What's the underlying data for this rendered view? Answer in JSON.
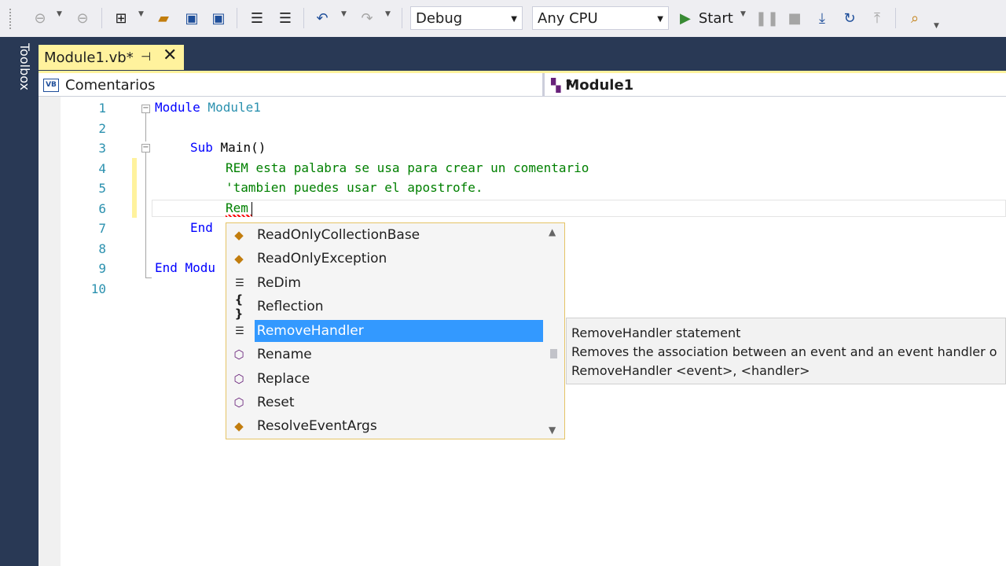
{
  "toolbar": {
    "config": "Debug",
    "platform": "Any CPU",
    "start_label": "Start"
  },
  "sidebar": {
    "toolbox_label": "Toolbox"
  },
  "tab": {
    "title": "Module1.vb*",
    "pin_glyph": "⊣",
    "close_glyph": "✕"
  },
  "navbar": {
    "left": "Comentarios",
    "right": "Module1",
    "vb_badge": "VB"
  },
  "editor": {
    "line_numbers": [
      "1",
      "2",
      "3",
      "4",
      "5",
      "6",
      "7",
      "8",
      "9",
      "10"
    ],
    "lines": {
      "l1_kw": "Module",
      "l1_name": " Module1",
      "l3_kw": "Sub",
      "l3_rest": " Main()",
      "l4": "REM esta palabra se usa para crear un comentario",
      "l5": "'tambien puedes usar el apostrofe.",
      "l6": "Rem",
      "l7": "End",
      "l9": "End Modu"
    }
  },
  "completion": {
    "items": [
      {
        "label": "ReadOnlyCollectionBase",
        "icon": "class-icon"
      },
      {
        "label": "ReadOnlyException",
        "icon": "class-icon"
      },
      {
        "label": "ReDim",
        "icon": "keyword-icon"
      },
      {
        "label": "Reflection",
        "icon": "namespace-icon"
      },
      {
        "label": "RemoveHandler",
        "icon": "keyword-icon",
        "selected": true
      },
      {
        "label": "Rename",
        "icon": "method-icon"
      },
      {
        "label": "Replace",
        "icon": "method-icon"
      },
      {
        "label": "Reset",
        "icon": "method-icon"
      },
      {
        "label": "ResolveEventArgs",
        "icon": "class-icon"
      }
    ]
  },
  "tooltip": {
    "title": "RemoveHandler statement",
    "description": "Removes the association between an event and an event handler o",
    "syntax": "RemoveHandler <event>, <handler>"
  },
  "colors": {
    "keyword": "#0000ff",
    "type": "#2b91af",
    "comment": "#008000",
    "tab_active": "#fff29d",
    "chrome": "#293955",
    "selection": "#3399ff"
  }
}
